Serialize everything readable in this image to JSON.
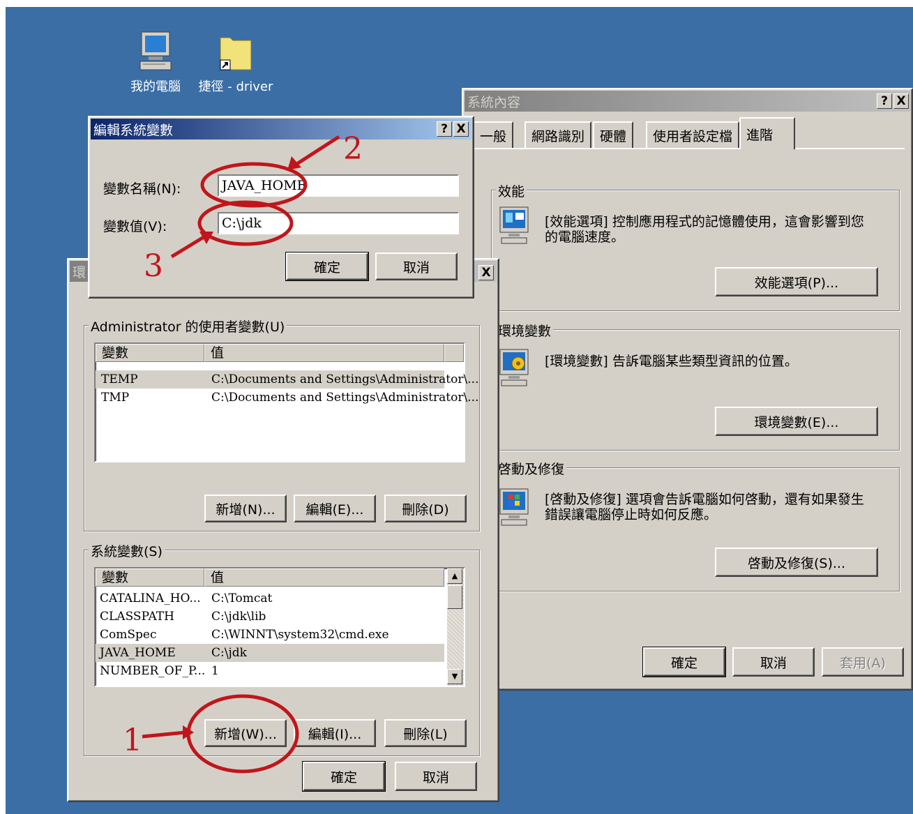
{
  "desktop": {
    "icons": [
      {
        "name": "my-computer-icon",
        "label": "我的電腦"
      },
      {
        "name": "folder-shortcut-icon",
        "label": "捷徑 - driver"
      }
    ]
  },
  "system_properties": {
    "title": "系統內容",
    "help_btn": "?",
    "close_btn": "X",
    "tabs": [
      "一般",
      "網路識別",
      "硬體",
      "使用者設定檔",
      "進階"
    ],
    "active_tab": "進階",
    "groups": {
      "performance": {
        "legend": "效能",
        "description": "[效能選項] 控制應用程式的記憶體使用，這會影響到您的電腦速度。",
        "button": "效能選項(P)..."
      },
      "environment": {
        "legend": "環境變數",
        "description": "[環境變數] 告訴電腦某些類型資訊的位置。",
        "button": "環境變數(E)..."
      },
      "startup": {
        "legend": "啓動及修復",
        "description": "[啓動及修復] 選項會告訴電腦如何啓動，還有如果發生錯誤讓電腦停止時如何反應。",
        "button": "啓動及修復(S)..."
      }
    },
    "buttons": {
      "ok": "確定",
      "cancel": "取消",
      "apply": "套用(A)"
    }
  },
  "env_vars": {
    "title_partial": "環",
    "close_btn": "X",
    "user_vars": {
      "legend": "Administrator 的使用者變數(U)",
      "columns": [
        "變數",
        "值"
      ],
      "rows": [
        {
          "var": "TEMP",
          "value": "C:\\Documents and Settings\\Administrator\\..."
        },
        {
          "var": "TMP",
          "value": "C:\\Documents and Settings\\Administrator\\..."
        }
      ],
      "buttons": {
        "new": "新增(N)...",
        "edit": "編輯(E)...",
        "delete": "刪除(D)"
      }
    },
    "system_vars": {
      "legend": "系統變數(S)",
      "columns": [
        "變數",
        "值"
      ],
      "rows": [
        {
          "var": "CATALINA_HO...",
          "value": "C:\\Tomcat"
        },
        {
          "var": "CLASSPATH",
          "value": "C:\\jdk\\lib"
        },
        {
          "var": "ComSpec",
          "value": "C:\\WINNT\\system32\\cmd.exe"
        },
        {
          "var": "JAVA_HOME",
          "value": "C:\\jdk"
        },
        {
          "var": "NUMBER_OF_P...",
          "value": "1"
        }
      ],
      "buttons": {
        "new": "新增(W)...",
        "edit": "編輯(I)...",
        "delete": "刪除(L)"
      }
    },
    "buttons": {
      "ok": "確定",
      "cancel": "取消"
    }
  },
  "edit_dialog": {
    "title": "編輯系統變數",
    "help_btn": "?",
    "close_btn": "X",
    "name_label": "變數名稱(N):",
    "name_value": "JAVA_HOME",
    "value_label": "變數值(V):",
    "value_value": "C:\\jdk",
    "buttons": {
      "ok": "確定",
      "cancel": "取消"
    }
  },
  "annotations": [
    "1",
    "2",
    "3"
  ],
  "colors": {
    "desktop": "#3a6ea5",
    "annotation": "#c0161b",
    "window": "#d4d0c8"
  }
}
